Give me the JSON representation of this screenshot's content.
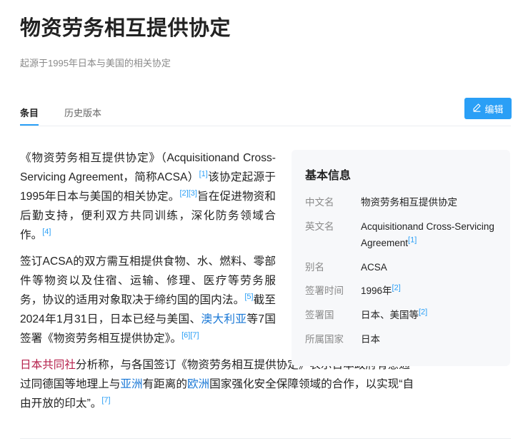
{
  "title": "物资劳务相互提供协定",
  "subtitle": "起源于1995年日本与美国的相关协定",
  "tabs": [
    {
      "label": "条目",
      "active": true
    },
    {
      "label": "历史版本",
      "active": false
    }
  ],
  "edit_button": {
    "label": "编辑",
    "icon": "pencil-icon"
  },
  "paragraphs": {
    "p1": {
      "t1": "《物资劳务相互提供协定》（Acquisitionand Cross-Servicing Agreement，简称ACSA）",
      "r1": "[1]",
      "t2": "该协定起源于1995年日本与美国的相关协定。",
      "r2": "[2]",
      "r3": "[3]",
      "t3": "旨在促进物资和后勤支持，便利双方共同训练，深化防务领域合作。",
      "r4": "[4]"
    },
    "p2": {
      "t1": "签订ACSA的双方需互相提供食物、水、燃料、零部件等物资以及住宿、运输、修理、医疗等劳务服务，协议的适用对象取决于缔约国的国内法。",
      "r5": "[5]",
      "t2": "截至2024年1月31日，日本已经与美国、",
      "link_australia": "澳大利亚",
      "t3": "等7国签署《物资劳务相互提供协定》。",
      "r6": "[6]",
      "r7": "[7]"
    },
    "p3": {
      "link_kyodo": "日本共同社",
      "t1": "分析称，与各国签订《物资劳务相互提供协定》表示日本政府有意通过同德国等地理上与",
      "link_asia": "亚洲",
      "t2": "有距离的",
      "link_europe": "欧洲",
      "t3": "国家强化安全保障领域的合作，以实现“自由开放的印太”。",
      "r7": "[7]"
    }
  },
  "infobox": {
    "title": "基本信息",
    "rows": [
      {
        "key": "中文名",
        "value": "物资劳务相互提供协定",
        "ref": ""
      },
      {
        "key": "英文名",
        "value": "Acquisitionand Cross-Servicing Agreement",
        "ref": "[1]"
      },
      {
        "key": "别名",
        "value": "ACSA",
        "ref": ""
      },
      {
        "key": "签署时间",
        "value": "1996年",
        "ref": "[2]"
      },
      {
        "key": "签署国",
        "value": "日本、美国等",
        "ref": "[2]"
      },
      {
        "key": "所属国家",
        "value": "日本",
        "ref": ""
      }
    ]
  },
  "colors": {
    "accent": "#2a9ff6",
    "link": "#1877d6",
    "link_alt": "#b5204b",
    "infobox_bg": "#f7f8fa"
  }
}
